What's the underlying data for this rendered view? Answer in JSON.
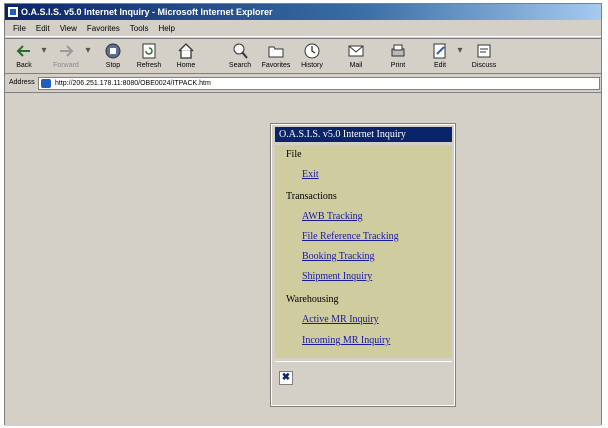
{
  "window": {
    "title": "O.A.S.I.S. v5.0 Internet Inquiry - Microsoft Internet Explorer"
  },
  "menubar": [
    "File",
    "Edit",
    "View",
    "Favorites",
    "Tools",
    "Help"
  ],
  "toolbar": {
    "back": "Back",
    "forward": "Forward",
    "stop": "Stop",
    "refresh": "Refresh",
    "home": "Home",
    "search": "Search",
    "favorites": "Favorites",
    "history": "History",
    "mail": "Mail",
    "print": "Print",
    "edit": "Edit",
    "discuss": "Discuss"
  },
  "address": {
    "label": "Address",
    "url": "http://206.251.178.11:8080/OBE0024/ITPACK.htm"
  },
  "oasis": {
    "title": "O.A.S.I.S. v5.0 Internet Inquiry",
    "groups": [
      {
        "label": "File",
        "items": [
          "Exit"
        ]
      },
      {
        "label": "Transactions",
        "items": [
          "AWB Tracking",
          "File Reference Tracking",
          "Booking Tracking",
          "Shipment Inquiry"
        ]
      },
      {
        "label": "Warehousing",
        "items": [
          "Active MR Inquiry",
          "Incoming MR Inquiry"
        ]
      }
    ],
    "close_symbol": "✖"
  }
}
